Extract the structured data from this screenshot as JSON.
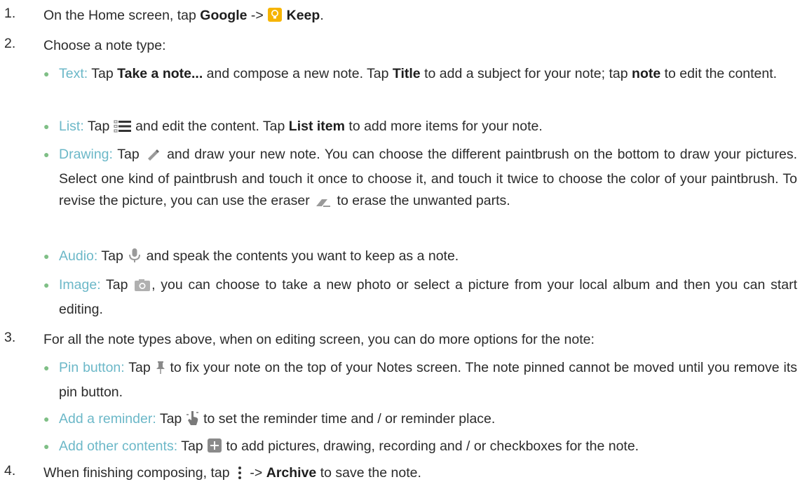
{
  "steps": [
    {
      "number": "1.",
      "before": "On the Home screen, tap",
      "bold1": "Google",
      "arrow": "->",
      "icon": "keep-icon",
      "bold2": "Keep",
      "after": "."
    },
    {
      "number": "2.",
      "text": "Choose a note type:",
      "items": [
        {
          "label": "Text:",
          "pre": "Tap",
          "bold1": "Take a note...",
          "mid1": "and compose a new note. Tap",
          "bold2": "Title",
          "mid2": "to add a subject for your note; tap",
          "bold3": "note",
          "post": "to edit the content."
        },
        {
          "label": "List:",
          "pre": "Tap",
          "icon": "list-icon",
          "mid": "and edit the content. Tap",
          "bold": "List item",
          "post": "to add more items for your note."
        },
        {
          "label": "Drawing:",
          "pre": "Tap",
          "icon": "pen-icon",
          "mid": "and draw your new note. You can choose the different paintbrush on the bottom to draw your pictures. Select one kind of paintbrush and touch it once to choose it, and touch it twice to choose the color of your paintbrush. To revise the picture, you can use the eraser",
          "icon2": "eraser-icon",
          "post": "to erase the unwanted parts."
        },
        {
          "label": "Audio:",
          "pre": "Tap",
          "icon": "microphone-icon",
          "post": "and speak the contents you want to keep as a note."
        },
        {
          "label": "Image:",
          "pre": "Tap",
          "icon": "camera-icon",
          "post": ", you can choose to take a new photo or select a picture from your local album and then you can start editing."
        }
      ]
    },
    {
      "number": "3.",
      "text": "For all the note types above, when on editing screen, you can do more options for the note:",
      "items": [
        {
          "label": "Pin button:",
          "pre": "Tap",
          "icon": "pin-icon",
          "post": "to fix your note on the top of your Notes screen. The note pinned cannot be moved until you remove its pin button."
        },
        {
          "label": "Add a reminder:",
          "pre": "Tap",
          "icon": "reminder-icon",
          "post": "to set the reminder time and / or reminder place."
        },
        {
          "label": "Add other contents:",
          "pre": "Tap",
          "icon": "add-icon",
          "post": "to add pictures, drawing, recording and / or checkboxes for the note."
        }
      ]
    },
    {
      "number": "4.",
      "before": "When finishing composing, tap",
      "icon": "more-vert-icon",
      "arrow": "->",
      "bold": "Archive",
      "after": "to save the note."
    }
  ],
  "colors": {
    "label": "#6cb8c8",
    "bullet": "#7fbf86",
    "keep": "#f6b400",
    "icon_gray": "#8a8a8a"
  }
}
